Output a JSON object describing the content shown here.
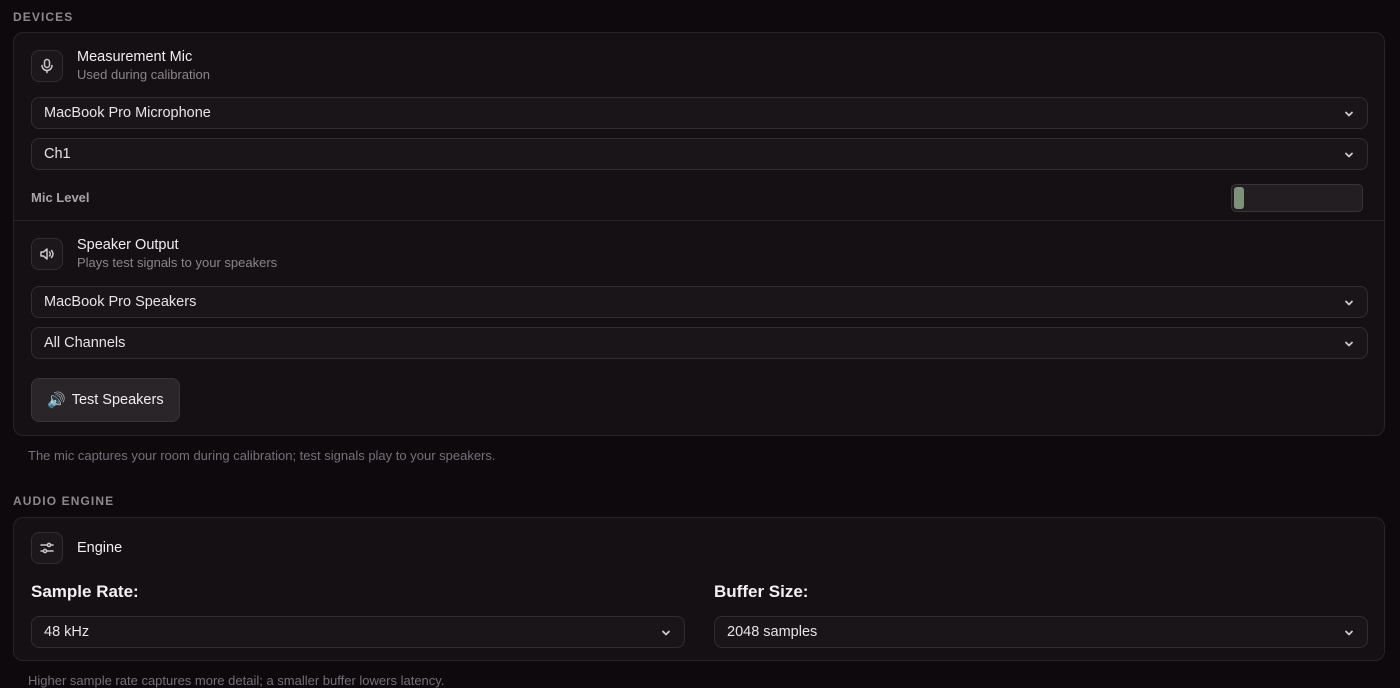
{
  "devices": {
    "section_label": "DEVICES",
    "mic": {
      "icon": "microphone-icon",
      "title": "Measurement Mic",
      "subtitle": "Used during calibration",
      "device_select": "MacBook Pro Microphone",
      "channel_select": "Ch1",
      "level_label": "Mic Level",
      "level_fraction": 0.08
    },
    "speaker": {
      "icon": "speaker-icon",
      "title": "Speaker Output",
      "subtitle": "Plays test signals to your speakers",
      "device_select": "MacBook Pro Speakers",
      "channel_select": "All Channels",
      "test_button_emoji": "🔊",
      "test_button_label": "Test Speakers"
    },
    "note": "The mic captures your room during calibration; test signals play to your speakers."
  },
  "audio_engine": {
    "section_label": "AUDIO ENGINE",
    "icon": "sliders-icon",
    "title": "Engine",
    "sample_rate_label": "Sample Rate:",
    "sample_rate_value": "48 kHz",
    "buffer_size_label": "Buffer Size:",
    "buffer_size_value": "2048 samples",
    "note": "Higher sample rate captures more detail; a smaller buffer lowers latency."
  },
  "colors": {
    "background": "#0d090c",
    "card": "#151013",
    "meter_fill": "#7f917a"
  }
}
